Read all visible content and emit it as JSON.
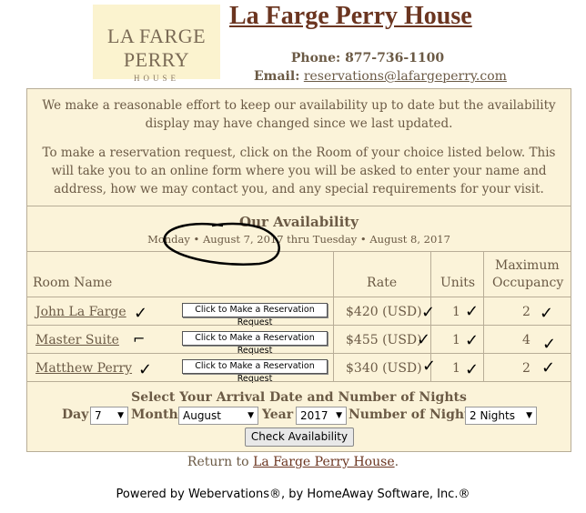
{
  "logo": {
    "line1": "LA FARGE PERRY",
    "line2": "HOUSE"
  },
  "site_title": "La Farge Perry House",
  "contact": {
    "phone_label": "Phone:",
    "phone": "877-736-1100",
    "email_label": "Email:",
    "email": "reservations@lafargeperry.com"
  },
  "notice": {
    "p1": "We make a reasonable effort to keep our availability up to date but the availability display may have changed since we last updated.",
    "p2": "To make a reservation request, click on the Room of your choice listed below. This will take you to an online form where you will be asked to enter your name and address, how we may contact you, and any special requirements for your visit."
  },
  "availability": {
    "title": "Our Availability",
    "range": "Monday • August 7, 2017 thru Tuesday • August 8, 2017"
  },
  "table": {
    "headers": {
      "room": "Room Name",
      "rate": "Rate",
      "units": "Units",
      "max1": "Maximum",
      "max2": "Occupancy"
    },
    "button_label": "Click to Make a Reservation Request",
    "rows": [
      {
        "room": "John La Farge",
        "rate": "$420 (USD)",
        "units": "1",
        "occupancy": "2"
      },
      {
        "room": "Master Suite",
        "rate": "$455 (USD)",
        "units": "1",
        "occupancy": "4"
      },
      {
        "room": "Matthew Perry",
        "rate": "$340 (USD)",
        "units": "1",
        "occupancy": "2"
      }
    ]
  },
  "form": {
    "title": "Select Your Arrival Date and Number of Nights",
    "day_label": "Day",
    "day_value": "7",
    "month_label": "Month",
    "month_value": "August",
    "year_label": "Year",
    "year_value": "2017",
    "nights_label": "Number of Nights",
    "nights_value": "2 Nights",
    "submit_label": "Check Availability"
  },
  "footer": {
    "return_prefix": "Return to",
    "return_link": "La Farge Perry House",
    "return_suffix": ".",
    "powered": "Powered by Webervations®, by HomeAway Software, Inc.®"
  },
  "colors": {
    "panel_bg": "#fbf3d9",
    "title": "#6b3520",
    "text": "#6b5a45"
  }
}
